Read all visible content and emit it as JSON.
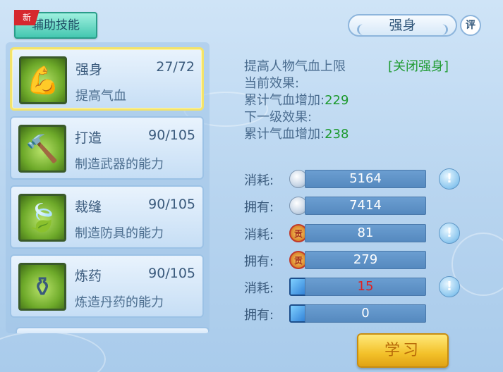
{
  "tab": {
    "label": "辅助技能",
    "badge": "新"
  },
  "skills": [
    {
      "name": "强身",
      "level": "27/72",
      "desc": "提高气血",
      "icon": "muscle-man-icon",
      "icon_glyph": "💪",
      "selected": true
    },
    {
      "name": "打造",
      "level": "90/105",
      "desc": "制造武器的能力",
      "icon": "hammer-icon",
      "icon_glyph": "🔨"
    },
    {
      "name": "裁缝",
      "level": "90/105",
      "desc": "制造防具的能力",
      "icon": "leaf-icon",
      "icon_glyph": "🍃"
    },
    {
      "name": "炼药",
      "level": "90/105",
      "desc": "炼造丹药的能力",
      "icon": "cauldron-icon",
      "icon_glyph": "⚱"
    }
  ],
  "detail": {
    "title": "强身",
    "rate_label": "评",
    "description": "提高人物气血上限",
    "close_link": "[关闭强身]",
    "current_effect_label": "当前效果:",
    "current_effect_text": "累计气血增加:",
    "current_effect_value": "229",
    "next_effect_label": "下一级效果:",
    "next_effect_text": "累计气血增加:",
    "next_effect_value": "238"
  },
  "costs": [
    {
      "label": "消耗:",
      "value": "5164",
      "icon": "silver-coin-icon",
      "info": true,
      "warn": false
    },
    {
      "label": "拥有:",
      "value": "7414",
      "icon": "silver-coin-icon",
      "info": false,
      "warn": false
    },
    {
      "label": "消耗:",
      "value": "81",
      "icon": "contribution-token-icon",
      "glyph": "贡",
      "info": true,
      "warn": false
    },
    {
      "label": "拥有:",
      "value": "279",
      "icon": "contribution-token-icon",
      "glyph": "贡",
      "info": false,
      "warn": false
    },
    {
      "label": "消耗:",
      "value": "15",
      "icon": "skill-book-icon",
      "info": true,
      "warn": true
    },
    {
      "label": "拥有:",
      "value": "0",
      "icon": "skill-book-icon",
      "info": false,
      "warn": false
    }
  ],
  "info_glyph": "!",
  "learn_button": "学习",
  "colors": {
    "accent_green": "#1d9a2f",
    "warn_red": "#e02020",
    "bar_blue": "#5589bf",
    "button_gold": "#f3c12a"
  }
}
